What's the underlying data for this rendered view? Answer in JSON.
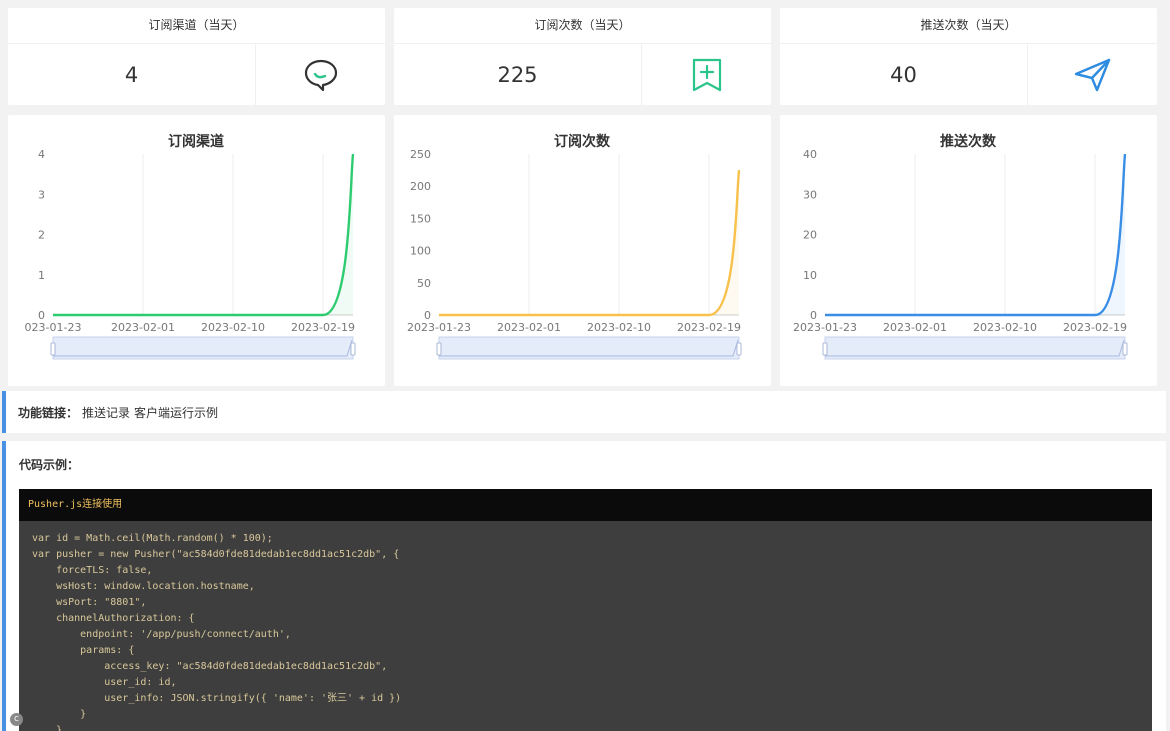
{
  "stats": [
    {
      "title": "订阅渠道（当天）",
      "value": "4",
      "icon": "chat-bubble-icon",
      "color": "#333333"
    },
    {
      "title": "订阅次数（当天）",
      "value": "225",
      "icon": "bookmark-add-icon",
      "color": "#2bc48a"
    },
    {
      "title": "推送次数（当天）",
      "value": "40",
      "icon": "paper-plane-icon",
      "color": "#2d8ce0"
    }
  ],
  "chart_data": [
    {
      "type": "line",
      "title": "订阅渠道",
      "color": "#2ecc71",
      "x": [
        "2023-01-23",
        "2023-02-01",
        "2023-02-10",
        "2023-02-19",
        "2023-02-22"
      ],
      "x_ticks": [
        "023-01-23",
        "2023-02-01",
        "2023-02-10",
        "2023-02-19"
      ],
      "series": [
        {
          "values": [
            0,
            0,
            0,
            0,
            4
          ]
        }
      ],
      "y_ticks": [
        "0",
        "1",
        "2",
        "3",
        "4"
      ],
      "ylim": [
        0,
        4
      ],
      "grid": true
    },
    {
      "type": "line",
      "title": "订阅次数",
      "color": "#f7c14b",
      "x": [
        "2023-01-23",
        "2023-02-01",
        "2023-02-10",
        "2023-02-19",
        "2023-02-22"
      ],
      "x_ticks": [
        "2023-01-23",
        "2023-02-01",
        "2023-02-10",
        "2023-02-19"
      ],
      "series": [
        {
          "values": [
            0,
            0,
            0,
            0,
            225
          ]
        }
      ],
      "y_ticks": [
        "0",
        "50",
        "100",
        "150",
        "200",
        "250"
      ],
      "ylim": [
        0,
        250
      ],
      "grid": true
    },
    {
      "type": "line",
      "title": "推送次数",
      "color": "#3a8ee6",
      "x": [
        "2023-01-23",
        "2023-02-01",
        "2023-02-10",
        "2023-02-19",
        "2023-02-22"
      ],
      "x_ticks": [
        "2023-01-23",
        "2023-02-01",
        "2023-02-10",
        "2023-02-19"
      ],
      "series": [
        {
          "values": [
            0,
            0,
            0,
            0,
            40
          ]
        }
      ],
      "y_ticks": [
        "0",
        "10",
        "20",
        "30",
        "40"
      ],
      "ylim": [
        0,
        40
      ],
      "grid": true
    }
  ],
  "func": {
    "label": "功能链接：",
    "links": [
      "推送记录",
      "客户端运行示例"
    ]
  },
  "code": {
    "label": "代码示例：",
    "head": "Pusher.js连接使用",
    "lines": [
      "var id = Math.ceil(Math.random() * 100);",
      "var pusher = new Pusher(\"ac584d0fde81dedab1ec8dd1ac51c2db\", {",
      "    forceTLS: false,",
      "    wsHost: window.location.hostname,",
      "    wsPort: \"8801\",",
      "    channelAuthorization: {",
      "        endpoint: '/app/push/connect/auth',",
      "        params: {",
      "            access_key: \"ac584d0fde81dedab1ec8dd1ac51c2db\",",
      "            user_id: id,",
      "            user_info: JSON.stringify({ 'name': '张三' + id })",
      "        }",
      "    }"
    ]
  },
  "corner_icon": "c"
}
